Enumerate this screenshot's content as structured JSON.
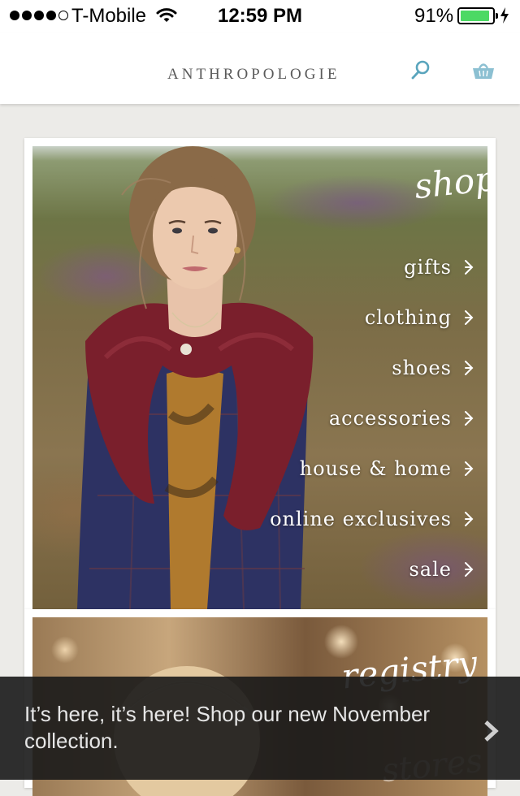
{
  "status_bar": {
    "carrier": "T-Mobile",
    "time": "12:59 PM",
    "battery_percent": "91%",
    "battery_level": 0.91,
    "battery_color": "#4cd964",
    "signal_bars_filled": 4,
    "signal_bars_total": 5
  },
  "nav": {
    "logo": "ANTHROPOLOGIE",
    "search_icon": "search-icon",
    "cart_icon": "basket-icon",
    "accent_color": "#5aa5bd"
  },
  "shop": {
    "heading": "shop",
    "items": [
      {
        "label": "gifts"
      },
      {
        "label": "clothing"
      },
      {
        "label": "shoes"
      },
      {
        "label": "accessories"
      },
      {
        "label": "house & home"
      },
      {
        "label": "online exclusives"
      },
      {
        "label": "sale"
      }
    ],
    "chevron_icon": "chevron-right-icon"
  },
  "registry": {
    "heading": "registry",
    "stores_heading": "stores"
  },
  "promo": {
    "text": "It’s here, it’s here! Shop our new November collection.",
    "chevron_icon": "chevron-right-icon"
  }
}
